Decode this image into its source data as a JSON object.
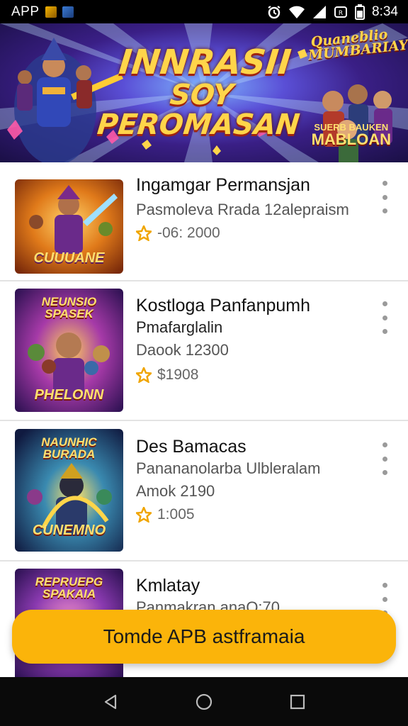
{
  "status_bar": {
    "app_label": "APP",
    "time": "8:34",
    "icons": [
      "notification-icon",
      "app-icon",
      "alarm-icon",
      "wifi-icon",
      "signal-icon",
      "data-icon",
      "battery-icon"
    ]
  },
  "banner": {
    "title_line1": "INNRASII",
    "title_line2": "SOY PEROMASAN",
    "badge_top": "Quaneblio MUMBARIAY",
    "sub_small": "SUERB BAUKEN",
    "sub_large": "MABLOAN"
  },
  "games": [
    {
      "title": "Ingamgar Permansjan",
      "line1": "Pasmoleva Rrada 12alepraism",
      "line2": "",
      "price": "-06: 2000",
      "thumb_label": "CUUUANE",
      "thumb_top": ""
    },
    {
      "title": "Kostloga Panfanpumh",
      "line1": "Pmafarglalin",
      "line2": "Daook 12300",
      "price": "$1908",
      "thumb_label": "PHELONN",
      "thumb_top": "NEUNSIO SPASEK"
    },
    {
      "title": "Des Bamacas",
      "line1": "Panananolarba Ulbleralam",
      "line2": "Amok 2190",
      "price": "1:005",
      "thumb_label": "CUNEMNO",
      "thumb_top": "NAUNHIC BURADA"
    },
    {
      "title": "Kmlatay",
      "line1": "Panmakran anaQ:70",
      "line2": "",
      "price": "",
      "thumb_label": "",
      "thumb_top": "REPRUEPG SPAKAIA"
    }
  ],
  "cta": {
    "label": "Tomde APB astframaia"
  },
  "nav": {
    "icons": [
      "back-icon",
      "home-icon",
      "recents-icon"
    ]
  },
  "colors": {
    "accent": "#fbb40a",
    "status_bar": "#000000",
    "nav_bar": "#0a0a0a",
    "divider": "#e3e3e3"
  }
}
